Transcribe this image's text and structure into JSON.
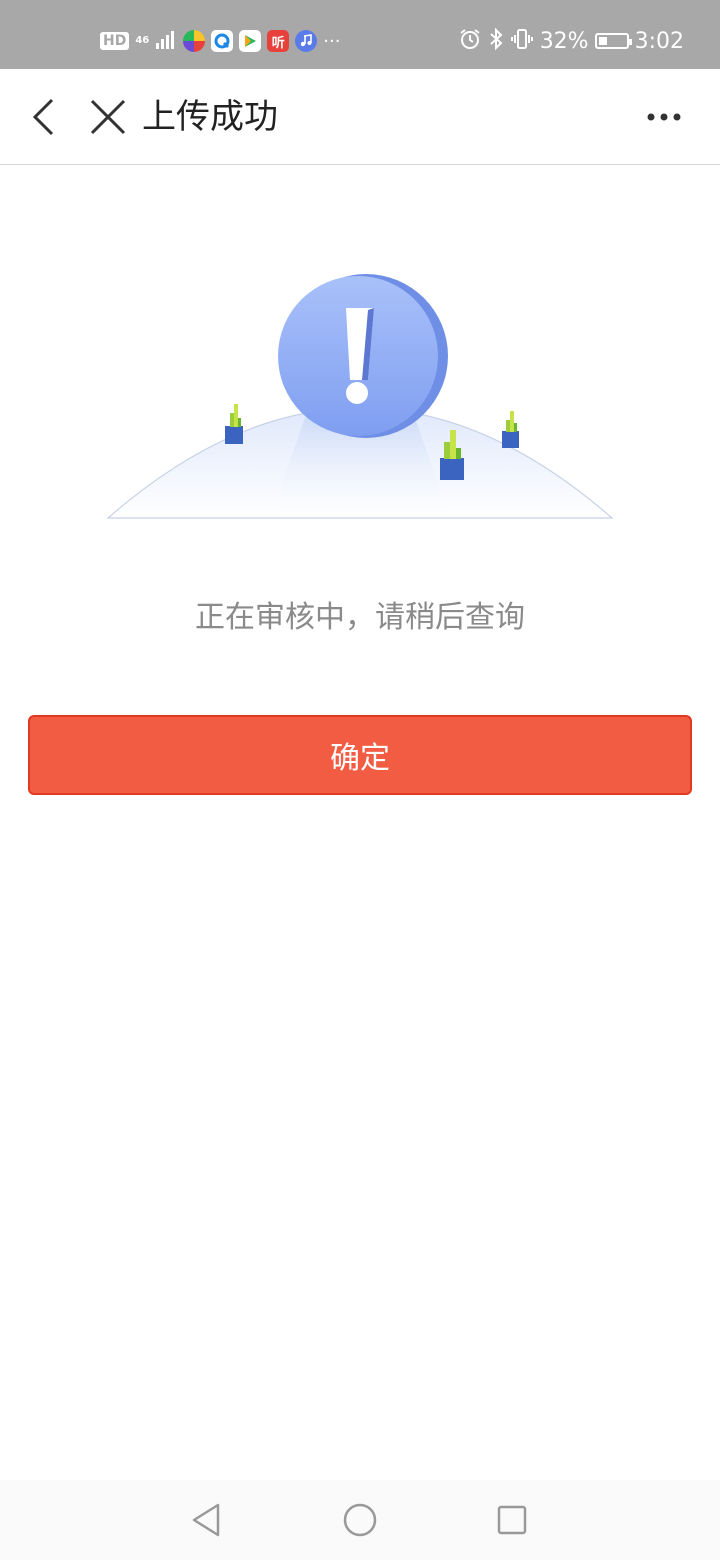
{
  "status_bar": {
    "hd_label": "HD",
    "network_label": "46",
    "battery_text": "32%",
    "battery_level": 0.32,
    "time": "3:02",
    "more_notifications": "···",
    "tingting_label": "听",
    "app_icons": [
      "colorful-circle-icon",
      "q-browser-icon",
      "video-play-icon",
      "tingting-app-icon",
      "music-note-icon"
    ]
  },
  "nav": {
    "title": "上传成功"
  },
  "main": {
    "message": "正在审核中，请稍后查询",
    "confirm_label": "确定"
  },
  "colors": {
    "accent": "#f25c42",
    "illustration_blue": "#8aa9f3",
    "text_gray": "#8a8a8a"
  }
}
